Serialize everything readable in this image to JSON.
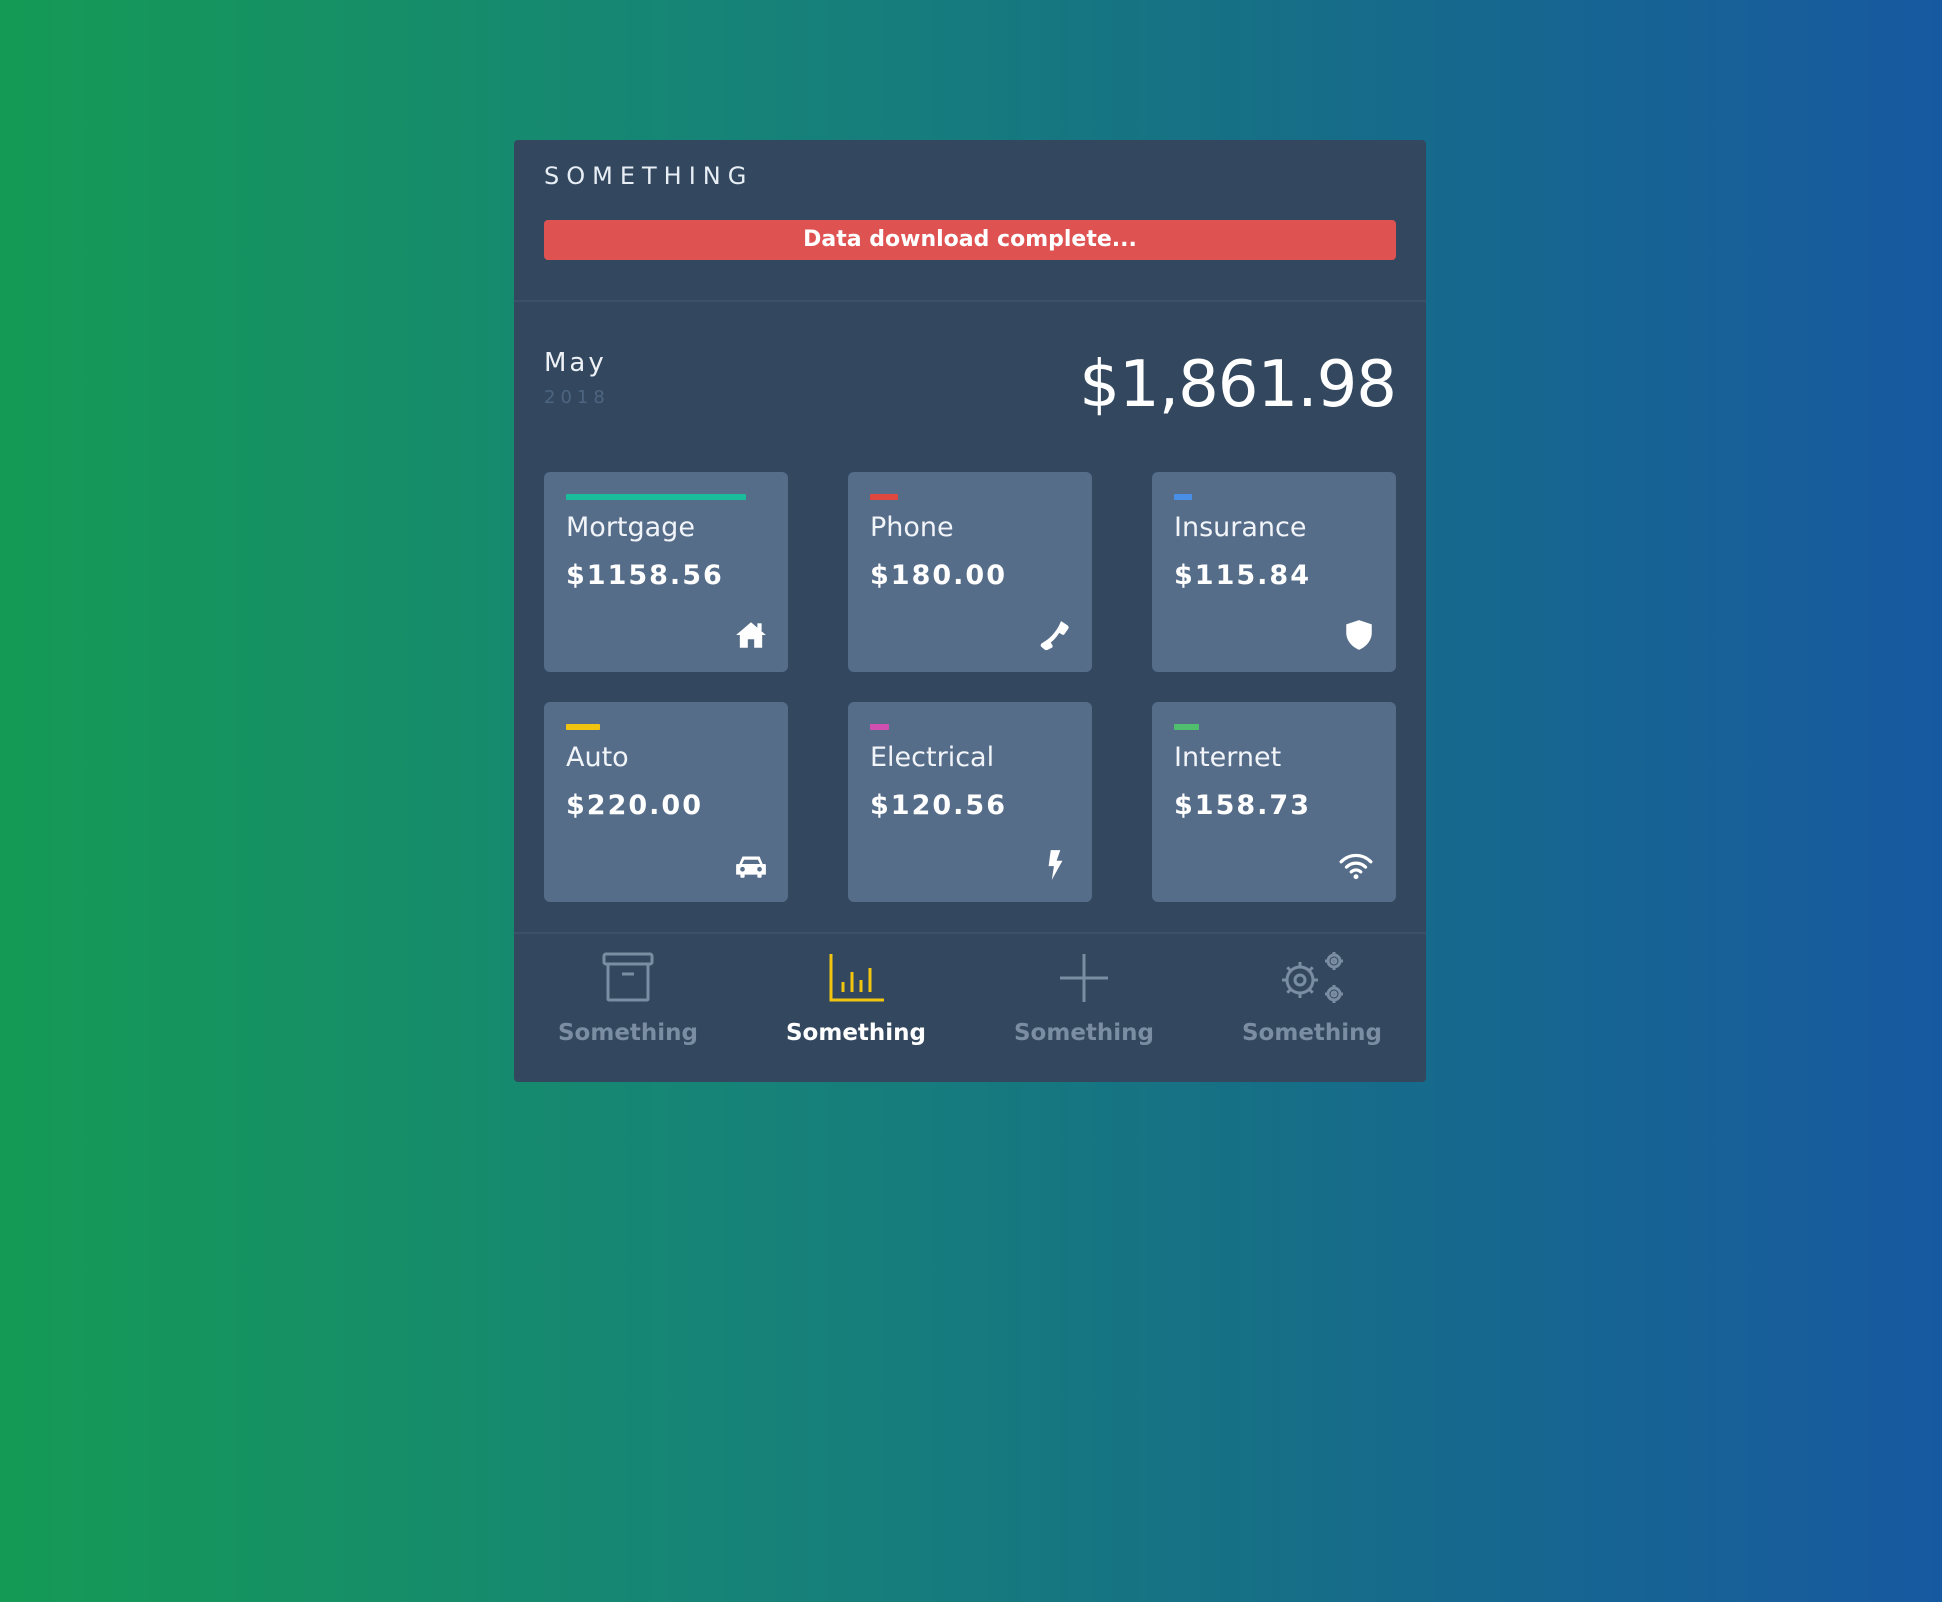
{
  "app_title": "SOMETHING",
  "alert": {
    "message": "Data download complete...",
    "color": "#df5252"
  },
  "summary": {
    "month": "May",
    "year": "2018",
    "total": "$1,861.98"
  },
  "cards": [
    {
      "label": "Mortgage",
      "amount": "$1158.56",
      "icon": "home-icon",
      "accent_color": "#1abc9c",
      "accent_fill": 1.0
    },
    {
      "label": "Phone",
      "amount": "$180.00",
      "icon": "phone-icon",
      "accent_color": "#e0473e",
      "accent_fill": 0.155
    },
    {
      "label": "Insurance",
      "amount": "$115.84",
      "icon": "shield-icon",
      "accent_color": "#4a8fe7",
      "accent_fill": 0.1
    },
    {
      "label": "Auto",
      "amount": "$220.00",
      "icon": "car-icon",
      "accent_color": "#f1c40f",
      "accent_fill": 0.19
    },
    {
      "label": "Electrical",
      "amount": "$120.56",
      "icon": "lightning-icon",
      "accent_color": "#d04fb1",
      "accent_fill": 0.104
    },
    {
      "label": "Internet",
      "amount": "$158.73",
      "icon": "wifi-icon",
      "accent_color": "#4fbf6d",
      "accent_fill": 0.137
    }
  ],
  "nav": {
    "items": [
      {
        "label": "Something",
        "icon": "archive-box-icon",
        "active": false
      },
      {
        "label": "Something",
        "icon": "bar-chart-icon",
        "active": true
      },
      {
        "label": "Something",
        "icon": "plus-icon",
        "active": false
      },
      {
        "label": "Something",
        "icon": "gears-icon",
        "active": false
      }
    ],
    "active_color": "#f1c40f",
    "inactive_color": "#7a8da2"
  }
}
